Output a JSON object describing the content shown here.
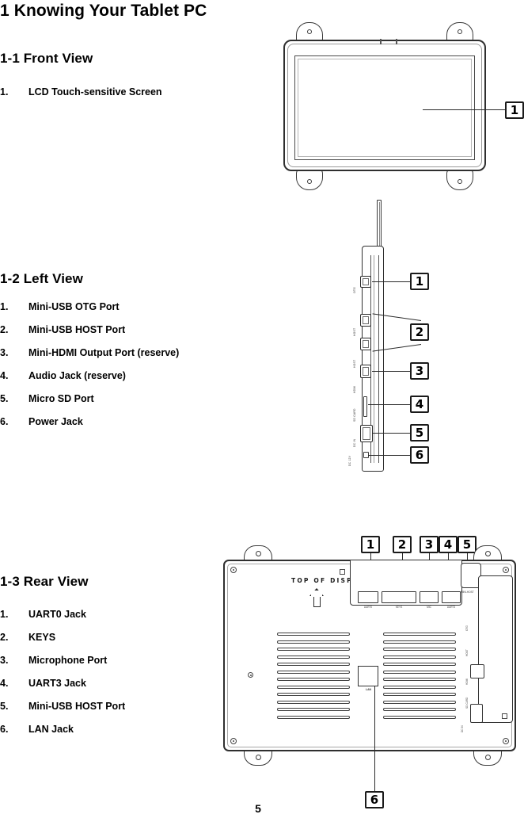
{
  "document": {
    "chapter_title": "1 Knowing Your Tablet PC",
    "page_number": "5"
  },
  "sections": [
    {
      "heading": "1-1 Front View",
      "items": [
        {
          "num": "1.",
          "label": "LCD Touch-sensitive Screen"
        }
      ]
    },
    {
      "heading": "1-2 Left View",
      "items": [
        {
          "num": "1.",
          "label": "Mini-USB OTG Port"
        },
        {
          "num": "2.",
          "label": "Mini-USB HOST Port"
        },
        {
          "num": "3.",
          "label": "Mini-HDMI Output Port (reserve)"
        },
        {
          "num": "4.",
          "label": "Audio Jack (reserve)"
        },
        {
          "num": "5.",
          "label": "Micro SD Port"
        },
        {
          "num": "6.",
          "label": "Power Jack"
        }
      ]
    },
    {
      "heading": "1-3 Rear View",
      "items": [
        {
          "num": "1.",
          "label": "UART0 Jack"
        },
        {
          "num": "2.",
          "label": "KEYS"
        },
        {
          "num": "3.",
          "label": "Microphone Port"
        },
        {
          "num": "4.",
          "label": "UART3 Jack"
        },
        {
          "num": "5.",
          "label": "Mini-USB HOST Port"
        },
        {
          "num": "6.",
          "label": "LAN Jack"
        }
      ]
    }
  ],
  "figures": {
    "front_view": {
      "callouts": [
        "1"
      ]
    },
    "left_view": {
      "callouts": [
        "1",
        "2",
        "3",
        "4",
        "5",
        "6"
      ],
      "port_labels": [
        "OTG",
        "HOST",
        "HOST",
        "HDMI",
        "SD CARD",
        "DC IN",
        "DC 12V"
      ]
    },
    "rear_view": {
      "callouts": [
        "1",
        "2",
        "3",
        "4",
        "5",
        "6"
      ],
      "orientation_label": "TOP OF DISPLAY",
      "connector_labels": [
        "UART0",
        "KEYS",
        "MIC",
        "UART3"
      ],
      "side_label": "MINI-HOST",
      "lan_label": "LAN",
      "edge_labels": [
        "OTG",
        "HOST",
        "HDMI",
        "SD CARD",
        "DC IN"
      ]
    }
  }
}
